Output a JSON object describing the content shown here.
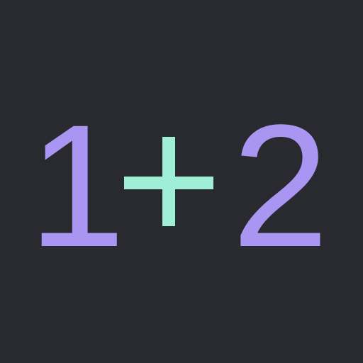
{
  "expression": {
    "left_operand": "1",
    "operator": "+",
    "right_operand": "2"
  },
  "colors": {
    "background": "#292a30",
    "operand": "#a996f3",
    "operator": "#9fefd6"
  }
}
